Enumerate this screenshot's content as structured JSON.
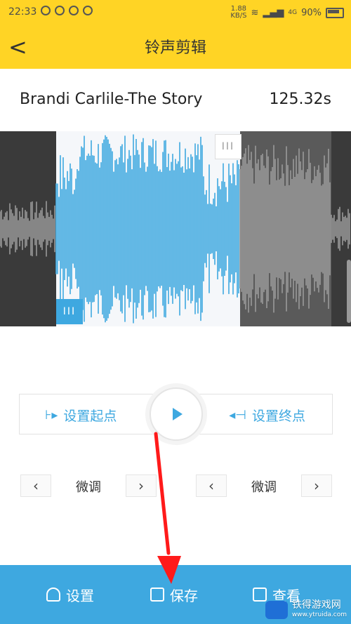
{
  "status": {
    "time": "22:33",
    "speed_top": "1.88",
    "speed_unit": "KB/S",
    "network": "4G",
    "battery": "90%"
  },
  "appbar": {
    "back_icon": "chevron-left-icon",
    "title": "铃声剪辑"
  },
  "song": {
    "title": "Brandi Carlile-The Story",
    "duration": "125.32s"
  },
  "waveform": {
    "selected_color": "#3ea8e0",
    "unselected_color": "#9a9a9a",
    "background_color": "#3a3a3a",
    "start_handle": "III",
    "end_handle": "III"
  },
  "controls": {
    "set_start": "设置起点",
    "set_end": "设置终点",
    "play_icon": "play-icon"
  },
  "fine_tune": {
    "left_label": "微调",
    "right_label": "微调",
    "prev_icon": "chevron-left-icon",
    "next_icon": "chevron-right-icon"
  },
  "bottom_bar": {
    "settings": "设置",
    "save": "保存",
    "view": "查看"
  },
  "watermark": {
    "name": "铁得游戏网",
    "url": "www.ytruida.com"
  },
  "colors": {
    "accent": "#ffd425",
    "primary": "#3ea8e0",
    "annotation": "#ff1a1a"
  }
}
